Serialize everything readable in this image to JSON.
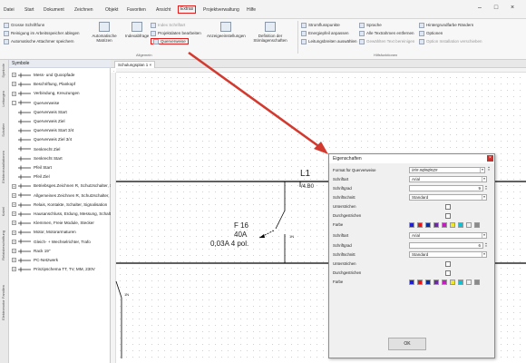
{
  "menu": {
    "items": [
      "Datei",
      "Start",
      "Dokument",
      "Zeichnen",
      "Objekt",
      "Favoriten",
      "Ansicht",
      "Extras",
      "Projektverwaltung",
      "Hilfe"
    ],
    "active_index": 7
  },
  "ribbon": {
    "items": {
      "bildausgabe": "Grosse Schriftfunn",
      "reinigung": "Reinigung im Arbeitsspeicher ablegen",
      "automatisch": "Automatische Attachmer speichern",
      "matrix_symbol": "Automatische Matrizen",
      "indexabfrage": "Indexabfrage",
      "index_schrift": "Index Schriftart",
      "projektdaten": "Projektdaten bearbeiten",
      "querverweise": "Querverweise",
      "anzeige": "Anzeigeeinstellungen",
      "definition": "Definition der Stirnlagenschaften",
      "stromfluss": "Stromflusspunkte",
      "energie": "Energiepfeil anpassen",
      "leitung": "Leitungsbreiten auswählen",
      "sprache": "Sprache",
      "textrahmen": "Alle Textrahmen entfernen",
      "text_rahmen_sub": "Gewählten Text bereinigen",
      "hintergrund": "Hintergrundfarbe Rändern",
      "optionen": "Optionen",
      "option_anzeigen": "Option Installation verschieben"
    },
    "group_label_left": "Allgemein",
    "group_label_right": "Hilfsfunktionen"
  },
  "vtabs": [
    "Symbole",
    "Leitungen",
    "Schalter",
    "Elektroinstallationen",
    "Kabel",
    "Relaisbeschriftung",
    "Elektromotor Familien"
  ],
  "symbols_panel": {
    "title": "Symbole",
    "tree": [
      {
        "label": "Mess- und Quoopfade",
        "toggle": "+",
        "indent": 0
      },
      {
        "label": "Beschriftung, Plankopf",
        "toggle": "+",
        "indent": 0
      },
      {
        "label": "Verbindung, Kreuzungen",
        "toggle": "+",
        "indent": 0
      },
      {
        "label": "Querverweise",
        "toggle": "-",
        "indent": 0
      },
      {
        "label": "Querverweis Start",
        "toggle": "",
        "indent": 1
      },
      {
        "label": "Querverweis Ziel",
        "toggle": "",
        "indent": 1
      },
      {
        "label": "Querverweis Start 3/4",
        "toggle": "",
        "indent": 1
      },
      {
        "label": "Querverweis Ziel 3/4",
        "toggle": "",
        "indent": 1
      },
      {
        "label": "Senkrecht Ziel",
        "toggle": "",
        "indent": 1
      },
      {
        "label": "Senkrecht Start",
        "toggle": "",
        "indent": 1
      },
      {
        "label": "Pfeil Start",
        "toggle": "",
        "indent": 1
      },
      {
        "label": "Pfeil Ziel",
        "toggle": "",
        "indent": 1
      },
      {
        "label": "Betriebsges.Zeichnen R, Schutzschalter, S",
        "toggle": "+",
        "indent": 0
      },
      {
        "label": "Allgemeines Zeichnen R, Schutzschalter, S",
        "toggle": "+",
        "indent": 0
      },
      {
        "label": "Relais, Kontakte, Schalter, Signalisation",
        "toggle": "+",
        "indent": 0
      },
      {
        "label": "Hausanschluss, Erdung, Messung, Schalt",
        "toggle": "+",
        "indent": 0
      },
      {
        "label": "Klemmen, Freie Module, Stecker",
        "toggle": "+",
        "indent": 0
      },
      {
        "label": "Motor, Motorarmaturen",
        "toggle": "+",
        "indent": 0
      },
      {
        "label": "Gleich- + Wechselrichter, Trafo",
        "toggle": "+",
        "indent": 0
      },
      {
        "label": "Rack 19\"",
        "toggle": "+",
        "indent": 0
      },
      {
        "label": "PC-Netzwerk",
        "toggle": "+",
        "indent": 0
      },
      {
        "label": "Prinzipschema TT, TV, MM, 230V",
        "toggle": "+",
        "indent": 0
      }
    ]
  },
  "document": {
    "tab_label": "Schulungsplan 1 ×"
  },
  "schematic": {
    "label_l1": "L1",
    "label_l1_ref": "/4.B0",
    "label_f16": "F 16",
    "label_40a": "40A",
    "label_rating": "0,03A 4 pol.",
    "label_1n": "1N",
    "label_bottom_left": "1N"
  },
  "dialog": {
    "title": "Eigenschaften",
    "close": "×",
    "format_label": "Format für Querverweise",
    "format_value": "/#/#.#Ø#Ø#Z#",
    "rows1": {
      "schriftart": "Schriftart",
      "schriftart_value": "Arial",
      "schriftgrad": "Schriftgrad",
      "schriftgrad_value": "9",
      "schriftschnitt": "Schriftschnitt",
      "schriftschnitt_value": "Standard",
      "unterstrichen": "Unterstrichen",
      "durchgestrichen": "Durchgestrichen",
      "farbe": "Farbe"
    },
    "rows2": {
      "schriftart": "Schriftart",
      "schriftart_value": "Arial",
      "schriftgrad": "Schriftgrad",
      "schriftgrad_value": "6",
      "schriftschnitt": "Schriftschnitt",
      "schriftschnitt_value": "Standard",
      "unterstrichen": "Unterstrichen",
      "durchgestrichen": "Durchgestrichen",
      "farbe": "Farbe"
    },
    "swatches": [
      "#1f1fd6",
      "#e01919",
      "#0b2f9e",
      "#6b2aa0",
      "#c41cc1",
      "#f0e62a",
      "#10c0d2",
      "#f1f1f1",
      "#8a8a8a"
    ],
    "ok": "OK"
  },
  "colors": {
    "highlight": "#e21b1b",
    "arrow": "#d33a2f"
  }
}
